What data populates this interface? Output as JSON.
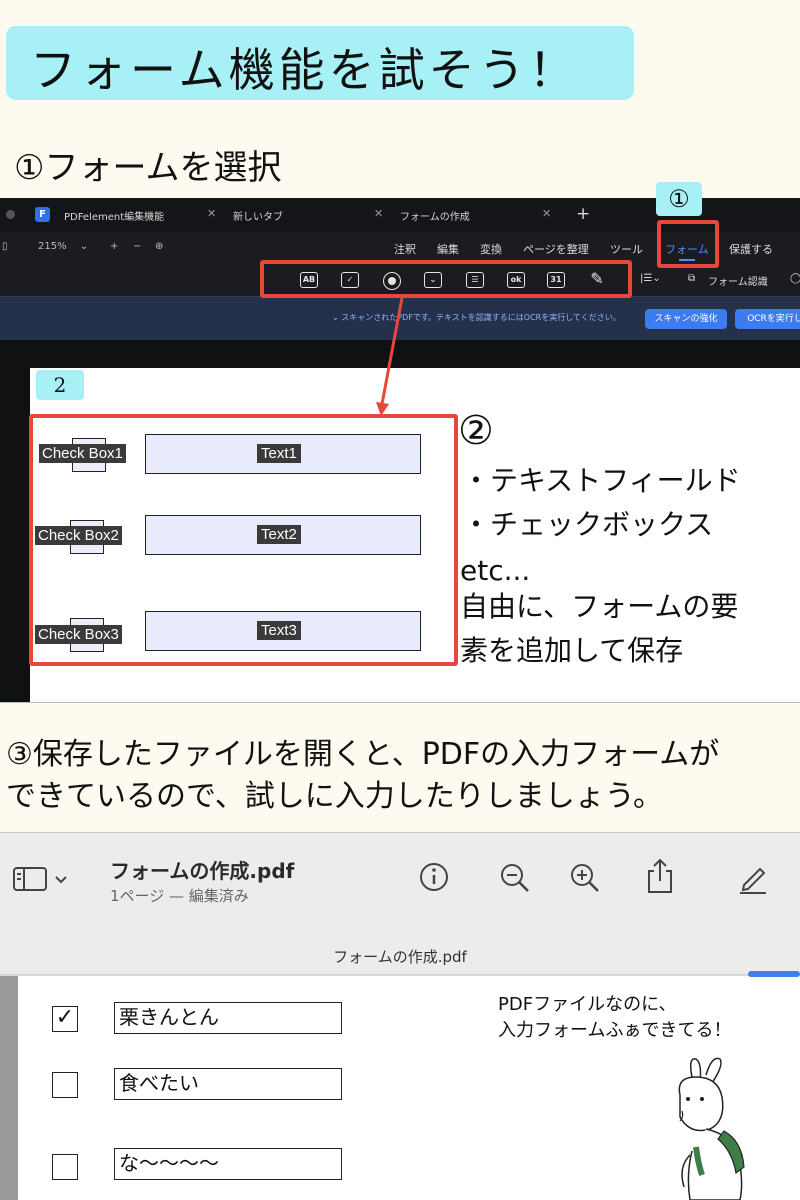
{
  "title": "フォーム機能を試そう！",
  "step1": "①フォームを選択",
  "callout1": "①",
  "callout2": "2",
  "editor": {
    "tabs": [
      {
        "label": "PDFelement編集機能"
      },
      {
        "label": "新しいタブ"
      },
      {
        "label": "フォームの作成"
      }
    ],
    "zoom": "215%",
    "menu": [
      "注釈",
      "編集",
      "変換",
      "ページを整理",
      "ツール",
      "フォーム",
      "保護する"
    ],
    "active_menu": "フォーム",
    "toolbar_icons": [
      "text-field-icon",
      "checkbox-icon",
      "radio-icon",
      "dropdown-icon",
      "listbox-icon",
      "button-icon",
      "date-icon",
      "signature-icon"
    ],
    "toolbar_labels": {
      "text_field": "AB",
      "button": "ok",
      "date": "31"
    },
    "form_recognition": "フォーム認識",
    "scan_message": "スキャンされたPDFです。テキストを認識するにはOCRを実行してください。",
    "scan_enhance": "スキャンの強化",
    "ocr_button": "OCRを実行し"
  },
  "form": {
    "checkboxes": [
      "Check Box1",
      "Check Box2",
      "Check Box3"
    ],
    "text_fields": [
      "Text1",
      "Text2",
      "Text3"
    ]
  },
  "step2": {
    "num": "②",
    "line1": "・テキストフィールド",
    "line2": "・チェックボックス",
    "line3": "etc...",
    "line4": "自由に、フォームの要",
    "line5": "素を追加して保存"
  },
  "step3": {
    "line1": "③保存したファイルを開くと、PDFの入力フォームが",
    "line2": "できているので、試しに入力したりしましょう。"
  },
  "preview": {
    "title": "フォームの作成.pdf",
    "subtitle": "1ページ — 編集済み",
    "tab": "フォームの作成.pdf",
    "rows": [
      {
        "checked": true,
        "check_mark": "✓",
        "text": "栗きんとん"
      },
      {
        "checked": false,
        "check_mark": "",
        "text": "食べたい"
      },
      {
        "checked": false,
        "check_mark": "",
        "text": "な〜〜〜〜"
      }
    ]
  },
  "note": {
    "line1": "PDFファイルなのに、",
    "line2": "入力フォームふぁできてる！"
  }
}
